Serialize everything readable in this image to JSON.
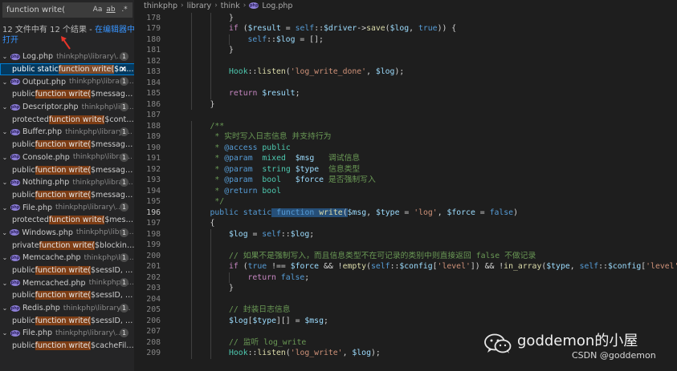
{
  "search": {
    "query": "function write(",
    "options": {
      "match_case": "Aa",
      "whole_word": "ab",
      "regex": ".*"
    },
    "summary": {
      "text": "12 文件中有 12 个结果 - ",
      "open_in_editor": "在编辑器中打开"
    }
  },
  "results": [
    {
      "file": "Log.php",
      "path": "thinkphp\\library\\think",
      "count": "1",
      "match": {
        "before": "public static ",
        "hit": "function write(",
        "after": "$m..."
      },
      "selected": true
    },
    {
      "file": "Output.php",
      "path": "thinkphp\\library\\...",
      "count": "1",
      "match": {
        "before": "public ",
        "hit": "function write(",
        "after": "$messages, $..."
      }
    },
    {
      "file": "Descriptor.php",
      "path": "thinkphp\\libr...",
      "count": "1",
      "match": {
        "before": "protected ",
        "hit": "function write(",
        "after": "$content, ..."
      }
    },
    {
      "file": "Buffer.php",
      "path": "thinkphp\\library\\t...",
      "count": "1",
      "match": {
        "before": "public ",
        "hit": "function write(",
        "after": "$messages, $..."
      }
    },
    {
      "file": "Console.php",
      "path": "thinkphp\\librar...",
      "count": "1",
      "match": {
        "before": "public ",
        "hit": "function write(",
        "after": "$messages, $..."
      }
    },
    {
      "file": "Nothing.php",
      "path": "thinkphp\\library...",
      "count": "1",
      "match": {
        "before": "public ",
        "hit": "function write(",
        "after": "$messages, $..."
      }
    },
    {
      "file": "File.php",
      "path": "thinkphp\\library\\thi...",
      "count": "1",
      "match": {
        "before": "protected ",
        "hit": "function write(",
        "after": "$message,..."
      }
    },
    {
      "file": "Windows.php",
      "path": "thinkphp\\library...",
      "count": "1",
      "match": {
        "before": "private ",
        "hit": "function write(",
        "after": "$blocking, $c..."
      }
    },
    {
      "file": "Memcache.php",
      "path": "thinkphp\\lib...",
      "count": "1",
      "match": {
        "before": "public ",
        "hit": "function write(",
        "after": "$sessID, $sess..."
      }
    },
    {
      "file": "Memcached.php",
      "path": "thinkphp\\li...",
      "count": "1",
      "match": {
        "before": "public ",
        "hit": "function write(",
        "after": "$sessID, $sess..."
      }
    },
    {
      "file": "Redis.php",
      "path": "thinkphp\\library\\t...",
      "count": "1",
      "match": {
        "before": "public ",
        "hit": "function write(",
        "after": "$sessID, $sess..."
      }
    },
    {
      "file": "File.php",
      "path": "thinkphp\\library\\thin...",
      "count": "1",
      "match": {
        "before": "public ",
        "hit": "function write(",
        "after": "$cacheFile, $c..."
      }
    }
  ],
  "breadcrumb": {
    "items": [
      "thinkphp",
      "library",
      "think"
    ],
    "file": "Log.php"
  },
  "editor": {
    "active_line": "196",
    "lines": [
      {
        "n": "178",
        "indent": 2,
        "tokens": [
          [
            "p",
            "}"
          ]
        ]
      },
      {
        "n": "179",
        "indent": 2,
        "tokens": [
          [
            "ctl",
            "if"
          ],
          [
            "p",
            " ("
          ],
          [
            "var",
            "$result"
          ],
          [
            "p",
            " = "
          ],
          [
            "kw",
            "self"
          ],
          [
            "p",
            "::"
          ],
          [
            "var",
            "$driver"
          ],
          [
            "p",
            "->"
          ],
          [
            "fn",
            "save"
          ],
          [
            "p",
            "("
          ],
          [
            "var",
            "$log"
          ],
          [
            "p",
            ", "
          ],
          [
            "kw",
            "true"
          ],
          [
            "p",
            ")) {"
          ]
        ]
      },
      {
        "n": "180",
        "indent": 3,
        "tokens": [
          [
            "kw",
            "self"
          ],
          [
            "p",
            "::"
          ],
          [
            "var",
            "$log"
          ],
          [
            "p",
            " = [];"
          ]
        ]
      },
      {
        "n": "181",
        "indent": 2,
        "tokens": [
          [
            "p",
            "}"
          ]
        ]
      },
      {
        "n": "182",
        "indent": 2,
        "tokens": []
      },
      {
        "n": "183",
        "indent": 2,
        "tokens": [
          [
            "cls",
            "Hook"
          ],
          [
            "p",
            "::"
          ],
          [
            "fn",
            "listen"
          ],
          [
            "p",
            "("
          ],
          [
            "str",
            "'log_write_done'"
          ],
          [
            "p",
            ", "
          ],
          [
            "var",
            "$log"
          ],
          [
            "p",
            ");"
          ]
        ]
      },
      {
        "n": "184",
        "indent": 2,
        "tokens": []
      },
      {
        "n": "185",
        "indent": 2,
        "tokens": [
          [
            "ctl",
            "return"
          ],
          [
            "p",
            " "
          ],
          [
            "var",
            "$result"
          ],
          [
            "p",
            ";"
          ]
        ]
      },
      {
        "n": "186",
        "indent": 1,
        "tokens": [
          [
            "p",
            "}"
          ]
        ]
      },
      {
        "n": "187",
        "indent": 0,
        "tokens": []
      },
      {
        "n": "188",
        "indent": 1,
        "tokens": [
          [
            "cm",
            "/**"
          ]
        ]
      },
      {
        "n": "189",
        "indent": 1,
        "tokens": [
          [
            "cm",
            " * 实时写入日志信息 并支持行为"
          ]
        ]
      },
      {
        "n": "190",
        "indent": 1,
        "tokens": [
          [
            "cm",
            " * "
          ],
          [
            "kw",
            "@access"
          ],
          [
            "cm",
            " "
          ],
          [
            "cls",
            "public"
          ]
        ]
      },
      {
        "n": "191",
        "indent": 1,
        "tokens": [
          [
            "cm",
            " * "
          ],
          [
            "kw",
            "@param"
          ],
          [
            "cm",
            "  "
          ],
          [
            "cls",
            "mixed"
          ],
          [
            "cm",
            "  "
          ],
          [
            "var",
            "$msg"
          ],
          [
            "cm",
            "   调试信息"
          ]
        ]
      },
      {
        "n": "192",
        "indent": 1,
        "tokens": [
          [
            "cm",
            " * "
          ],
          [
            "kw",
            "@param"
          ],
          [
            "cm",
            "  "
          ],
          [
            "cls",
            "string"
          ],
          [
            "cm",
            " "
          ],
          [
            "var",
            "$type"
          ],
          [
            "cm",
            "  信息类型"
          ]
        ]
      },
      {
        "n": "193",
        "indent": 1,
        "tokens": [
          [
            "cm",
            " * "
          ],
          [
            "kw",
            "@param"
          ],
          [
            "cm",
            "  "
          ],
          [
            "cls",
            "bool"
          ],
          [
            "cm",
            "   "
          ],
          [
            "var",
            "$force"
          ],
          [
            "cm",
            " 是否强制写入"
          ]
        ]
      },
      {
        "n": "194",
        "indent": 1,
        "tokens": [
          [
            "cm",
            " * "
          ],
          [
            "kw",
            "@return"
          ],
          [
            "cm",
            " "
          ],
          [
            "cls",
            "bool"
          ]
        ]
      },
      {
        "n": "195",
        "indent": 1,
        "tokens": [
          [
            "cm",
            " */"
          ]
        ]
      },
      {
        "n": "196",
        "indent": 1,
        "tokens": [
          [
            "kw",
            "public"
          ],
          [
            "p",
            " "
          ],
          [
            "kw",
            "static"
          ],
          [
            "sel",
            " "
          ],
          [
            "sel kw",
            "function"
          ],
          [
            "sel",
            " "
          ],
          [
            "sel fn",
            "write"
          ],
          [
            "sel",
            "("
          ],
          [
            "var",
            "$msg"
          ],
          [
            "p",
            ", "
          ],
          [
            "var",
            "$type"
          ],
          [
            "p",
            " = "
          ],
          [
            "str",
            "'log'"
          ],
          [
            "p",
            ", "
          ],
          [
            "var",
            "$force"
          ],
          [
            "p",
            " = "
          ],
          [
            "kw",
            "false"
          ],
          [
            "p",
            ")"
          ]
        ]
      },
      {
        "n": "197",
        "indent": 1,
        "tokens": [
          [
            "p",
            "{"
          ]
        ]
      },
      {
        "n": "198",
        "indent": 2,
        "tokens": [
          [
            "var",
            "$log"
          ],
          [
            "p",
            " = "
          ],
          [
            "kw",
            "self"
          ],
          [
            "p",
            "::"
          ],
          [
            "var",
            "$log"
          ],
          [
            "p",
            ";"
          ]
        ]
      },
      {
        "n": "199",
        "indent": 2,
        "tokens": []
      },
      {
        "n": "200",
        "indent": 2,
        "tokens": [
          [
            "cm",
            "// 如果不是强制写入，而且信息类型不在可记录的类别中则直接返回 false 不做记录"
          ]
        ]
      },
      {
        "n": "201",
        "indent": 2,
        "tokens": [
          [
            "ctl",
            "if"
          ],
          [
            "p",
            " ("
          ],
          [
            "kw",
            "true"
          ],
          [
            "p",
            " !== "
          ],
          [
            "var",
            "$force"
          ],
          [
            "p",
            " && !"
          ],
          [
            "fn",
            "empty"
          ],
          [
            "p",
            "("
          ],
          [
            "kw",
            "self"
          ],
          [
            "p",
            "::"
          ],
          [
            "var",
            "$config"
          ],
          [
            "p",
            "["
          ],
          [
            "str",
            "'level'"
          ],
          [
            "p",
            "]) && !"
          ],
          [
            "fn",
            "in_array"
          ],
          [
            "p",
            "("
          ],
          [
            "var",
            "$type"
          ],
          [
            "p",
            ", "
          ],
          [
            "kw",
            "self"
          ],
          [
            "p",
            "::"
          ],
          [
            "var",
            "$config"
          ],
          [
            "p",
            "["
          ],
          [
            "str",
            "'level'"
          ],
          [
            "p",
            "])) {"
          ]
        ]
      },
      {
        "n": "202",
        "indent": 3,
        "tokens": [
          [
            "ctl",
            "return"
          ],
          [
            "p",
            " "
          ],
          [
            "kw",
            "false"
          ],
          [
            "p",
            ";"
          ]
        ]
      },
      {
        "n": "203",
        "indent": 2,
        "tokens": [
          [
            "p",
            "}"
          ]
        ]
      },
      {
        "n": "204",
        "indent": 2,
        "tokens": []
      },
      {
        "n": "205",
        "indent": 2,
        "tokens": [
          [
            "cm",
            "// 封装日志信息"
          ]
        ]
      },
      {
        "n": "206",
        "indent": 2,
        "tokens": [
          [
            "var",
            "$log"
          ],
          [
            "p",
            "["
          ],
          [
            "var",
            "$type"
          ],
          [
            "p",
            "][] = "
          ],
          [
            "var",
            "$msg"
          ],
          [
            "p",
            ";"
          ]
        ]
      },
      {
        "n": "207",
        "indent": 2,
        "tokens": []
      },
      {
        "n": "208",
        "indent": 2,
        "tokens": [
          [
            "cm",
            "// 监听 log_write"
          ]
        ]
      },
      {
        "n": "209",
        "indent": 2,
        "tokens": [
          [
            "cls",
            "Hook"
          ],
          [
            "p",
            "::"
          ],
          [
            "fn",
            "listen"
          ],
          [
            "p",
            "("
          ],
          [
            "str",
            "'log_write'"
          ],
          [
            "p",
            ", "
          ],
          [
            "var",
            "$log"
          ],
          [
            "p",
            ");"
          ]
        ]
      }
    ]
  },
  "watermark": {
    "title": "goddemon的小屋",
    "csdn": "CSDN @goddemon"
  },
  "colors": {
    "accent_link": "#3794ff",
    "match_highlight": "#ea5c00",
    "selection": "#264f78",
    "php_icon": "#8c7ed6",
    "arrow": "#e8352a"
  },
  "icons": {
    "php_file": "php-file-icon",
    "expanded": "chevron-down-icon",
    "dismiss": "close-icon",
    "wechat": "wechat-logo"
  }
}
